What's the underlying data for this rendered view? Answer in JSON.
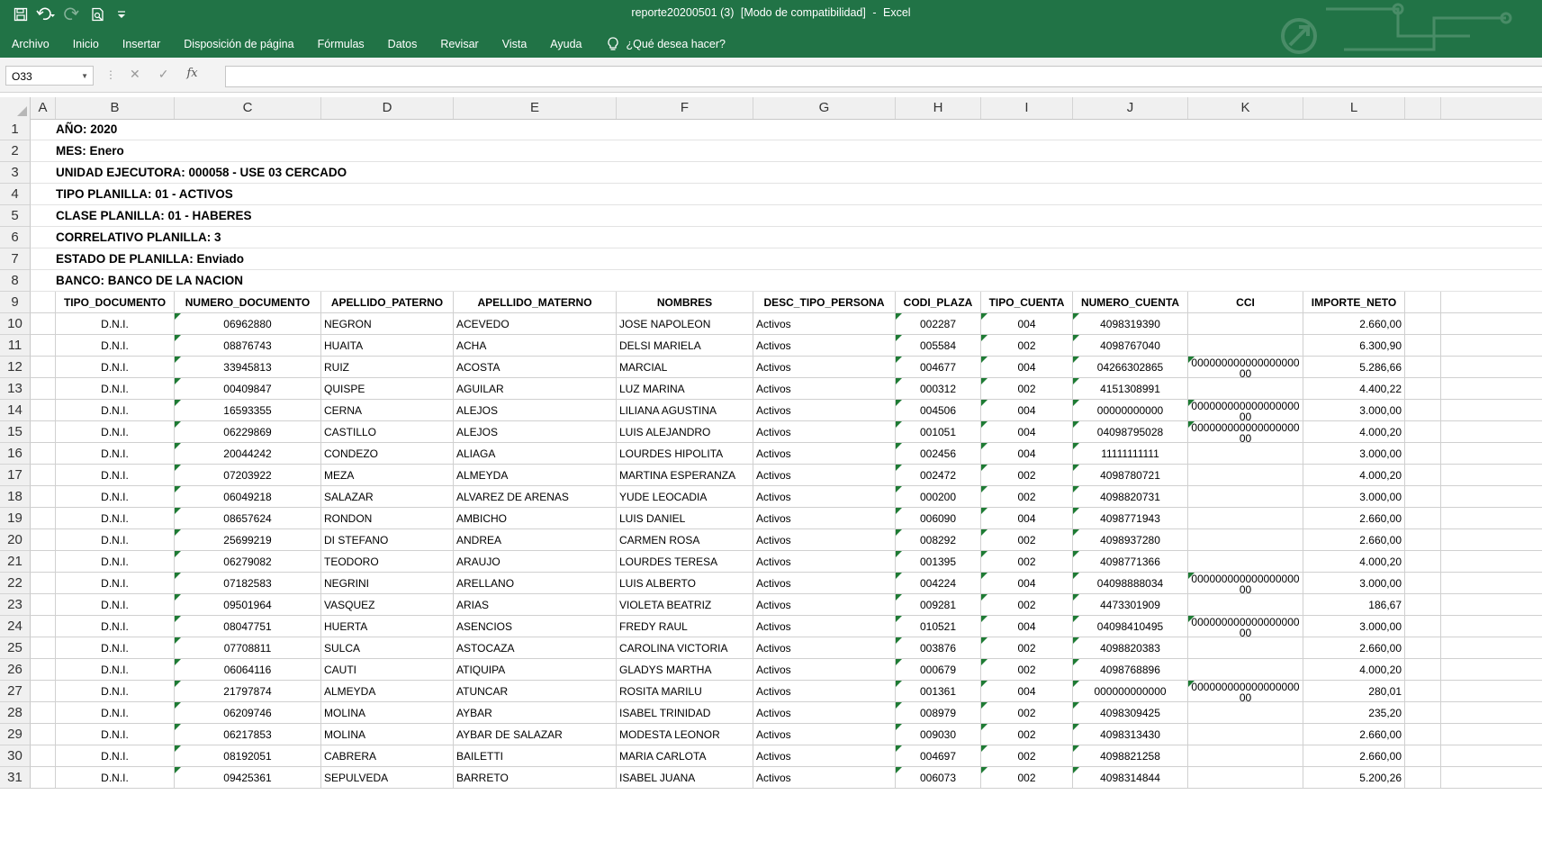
{
  "window": {
    "title_file": "reporte20200501 (3)",
    "title_mode": "[Modo de compatibilidad]",
    "title_sep": "-",
    "title_app": "Excel"
  },
  "qat": {
    "save_icon": "save-icon",
    "undo_icon": "undo-icon",
    "redo_icon": "redo-icon",
    "preview_icon": "print-preview-icon",
    "customize_icon": "customize-icon"
  },
  "menu": {
    "items": [
      "Archivo",
      "Inicio",
      "Insertar",
      "Disposición de página",
      "Fórmulas",
      "Datos",
      "Revisar",
      "Vista",
      "Ayuda"
    ],
    "tell_me": "¿Qué desea hacer?"
  },
  "formula_bar": {
    "name_box": "O33",
    "formula": ""
  },
  "columns": [
    "A",
    "B",
    "C",
    "D",
    "E",
    "F",
    "G",
    "H",
    "I",
    "J",
    "K",
    "L"
  ],
  "info_rows": [
    "AÑO: 2020",
    "MES: Enero",
    "UNIDAD EJECUTORA: 000058 - USE 03 CERCADO",
    "TIPO PLANILLA: 01 - ACTIVOS",
    "CLASE PLANILLA: 01 - HABERES",
    "CORRELATIVO PLANILLA: 3",
    "ESTADO DE PLANILLA: Enviado",
    "BANCO: BANCO DE LA NACION"
  ],
  "table": {
    "headers": [
      "TIPO_DOCUMENTO",
      "NUMERO_DOCUMENTO",
      "APELLIDO_PATERNO",
      "APELLIDO_MATERNO",
      "NOMBRES",
      "DESC_TIPO_PERSONA",
      "CODI_PLAZA",
      "TIPO_CUENTA",
      "NUMERO_CUENTA",
      "CCI",
      "IMPORTE_NETO"
    ],
    "rows": [
      [
        "D.N.I.",
        "06962880",
        "NEGRON",
        "ACEVEDO",
        "JOSE NAPOLEON",
        "Activos",
        "002287",
        "004",
        "4098319390",
        "",
        "2.660,00"
      ],
      [
        "D.N.I.",
        "08876743",
        "HUAITA",
        "ACHA",
        "DELSI MARIELA",
        "Activos",
        "005584",
        "002",
        "4098767040",
        "",
        "6.300,90"
      ],
      [
        "D.N.I.",
        "33945813",
        "RUIZ",
        "ACOSTA",
        "MARCIAL",
        "Activos",
        "004677",
        "004",
        "04266302865",
        "00000000000000000000",
        "5.286,66"
      ],
      [
        "D.N.I.",
        "00409847",
        "QUISPE",
        "AGUILAR",
        "LUZ MARINA",
        "Activos",
        "000312",
        "002",
        "4151308991",
        "",
        "4.400,22"
      ],
      [
        "D.N.I.",
        "16593355",
        "CERNA",
        "ALEJOS",
        "LILIANA AGUSTINA",
        "Activos",
        "004506",
        "004",
        "00000000000",
        "00000000000000000000",
        "3.000,00"
      ],
      [
        "D.N.I.",
        "06229869",
        "CASTILLO",
        "ALEJOS",
        "LUIS ALEJANDRO",
        "Activos",
        "001051",
        "004",
        "04098795028",
        "00000000000000000000",
        "4.000,20"
      ],
      [
        "D.N.I.",
        "20044242",
        "CONDEZO",
        "ALIAGA",
        "LOURDES HIPOLITA",
        "Activos",
        "002456",
        "004",
        "11111111111",
        "",
        "3.000,00"
      ],
      [
        "D.N.I.",
        "07203922",
        "MEZA",
        "ALMEYDA",
        "MARTINA ESPERANZA",
        "Activos",
        "002472",
        "002",
        "4098780721",
        "",
        "4.000,20"
      ],
      [
        "D.N.I.",
        "06049218",
        "SALAZAR",
        "ALVAREZ DE ARENAS",
        "YUDE LEOCADIA",
        "Activos",
        "000200",
        "002",
        "4098820731",
        "",
        "3.000,00"
      ],
      [
        "D.N.I.",
        "08657624",
        "RONDON",
        "AMBICHO",
        "LUIS DANIEL",
        "Activos",
        "006090",
        "004",
        "4098771943",
        "",
        "2.660,00"
      ],
      [
        "D.N.I.",
        "25699219",
        "DI STEFANO",
        "ANDREA",
        "CARMEN ROSA",
        "Activos",
        "008292",
        "002",
        "4098937280",
        "",
        "2.660,00"
      ],
      [
        "D.N.I.",
        "06279082",
        "TEODORO",
        "ARAUJO",
        "LOURDES TERESA",
        "Activos",
        "001395",
        "002",
        "4098771366",
        "",
        "4.000,20"
      ],
      [
        "D.N.I.",
        "07182583",
        "NEGRINI",
        "ARELLANO",
        "LUIS ALBERTO",
        "Activos",
        "004224",
        "004",
        "04098888034",
        "00000000000000000000",
        "3.000,00"
      ],
      [
        "D.N.I.",
        "09501964",
        "VASQUEZ",
        "ARIAS",
        "VIOLETA BEATRIZ",
        "Activos",
        "009281",
        "002",
        "4473301909",
        "",
        "186,67"
      ],
      [
        "D.N.I.",
        "08047751",
        "HUERTA",
        "ASENCIOS",
        "FREDY RAUL",
        "Activos",
        "010521",
        "004",
        "04098410495",
        "00000000000000000000",
        "3.000,00"
      ],
      [
        "D.N.I.",
        "07708811",
        "SULCA",
        "ASTOCAZA",
        "CAROLINA VICTORIA",
        "Activos",
        "003876",
        "002",
        "4098820383",
        "",
        "2.660,00"
      ],
      [
        "D.N.I.",
        "06064116",
        "CAUTI",
        "ATIQUIPA",
        "GLADYS MARTHA",
        "Activos",
        "000679",
        "002",
        "4098768896",
        "",
        "4.000,20"
      ],
      [
        "D.N.I.",
        "21797874",
        "ALMEYDA",
        "ATUNCAR",
        "ROSITA MARILU",
        "Activos",
        "001361",
        "004",
        "000000000000",
        "00000000000000000000",
        "280,01"
      ],
      [
        "D.N.I.",
        "06209746",
        "MOLINA",
        "AYBAR",
        "ISABEL TRINIDAD",
        "Activos",
        "008979",
        "002",
        "4098309425",
        "",
        "235,20"
      ],
      [
        "D.N.I.",
        "06217853",
        "MOLINA",
        "AYBAR DE SALAZAR",
        "MODESTA LEONOR",
        "Activos",
        "009030",
        "002",
        "4098313430",
        "",
        "2.660,00"
      ],
      [
        "D.N.I.",
        "08192051",
        "CABRERA",
        "BAILETTI",
        "MARIA CARLOTA",
        "Activos",
        "004697",
        "002",
        "4098821258",
        "",
        "2.660,00"
      ],
      [
        "D.N.I.",
        "09425361",
        "SEPULVEDA",
        "BARRETO",
        "ISABEL JUANA",
        "Activos",
        "006073",
        "002",
        "4098314844",
        "",
        "5.200,26"
      ]
    ]
  },
  "colors": {
    "excel_green": "#217346",
    "error_triangle": "#1e7b34"
  }
}
